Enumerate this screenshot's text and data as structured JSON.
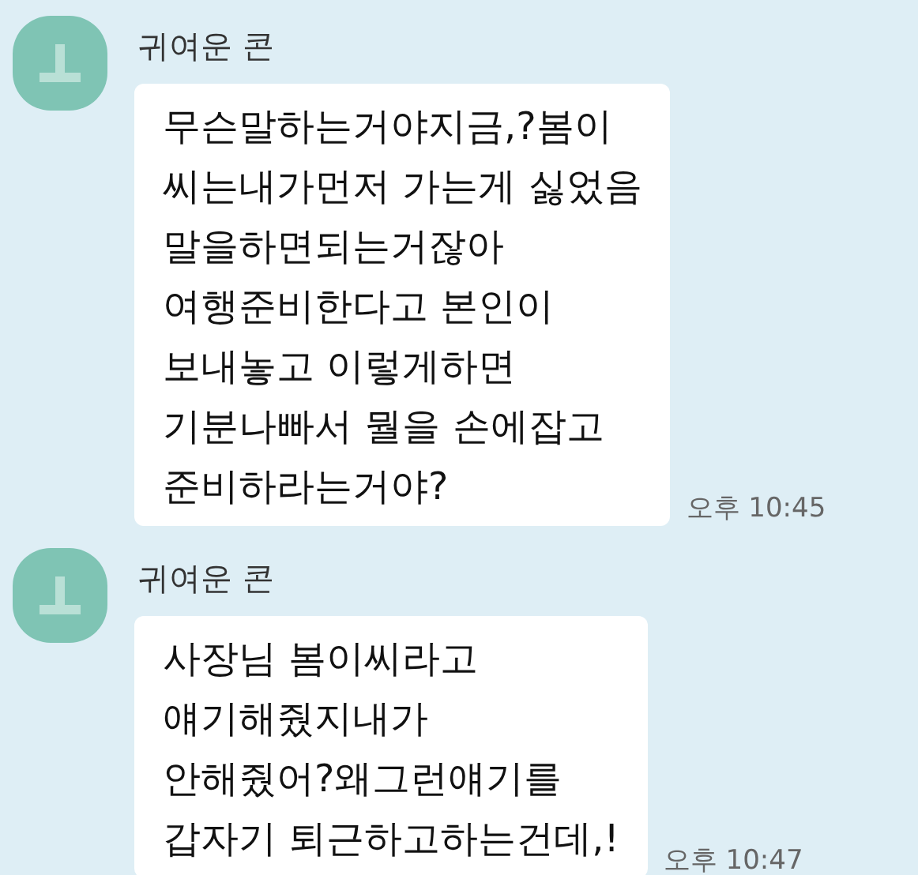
{
  "messages": [
    {
      "sender": "귀여운 콘",
      "lines": [
        "무슨말하는거야지금,?봄이",
        "씨는내가먼저 가는게 싫었음",
        "말을하면되는거잖아",
        "여행준비한다고 본인이",
        "보내놓고 이렇게하면",
        "기분나빠서 뭘을 손에잡고",
        "준비하라는거야?"
      ],
      "time": "오후 10:45"
    },
    {
      "sender": "귀여운 콘",
      "lines": [
        "사장님 봄이씨라고",
        "얘기해줬지내가",
        "안해줬어?왜그런얘기를",
        "갑자기 퇴근하고하는건데,!"
      ],
      "time": "오후 10:47"
    }
  ]
}
